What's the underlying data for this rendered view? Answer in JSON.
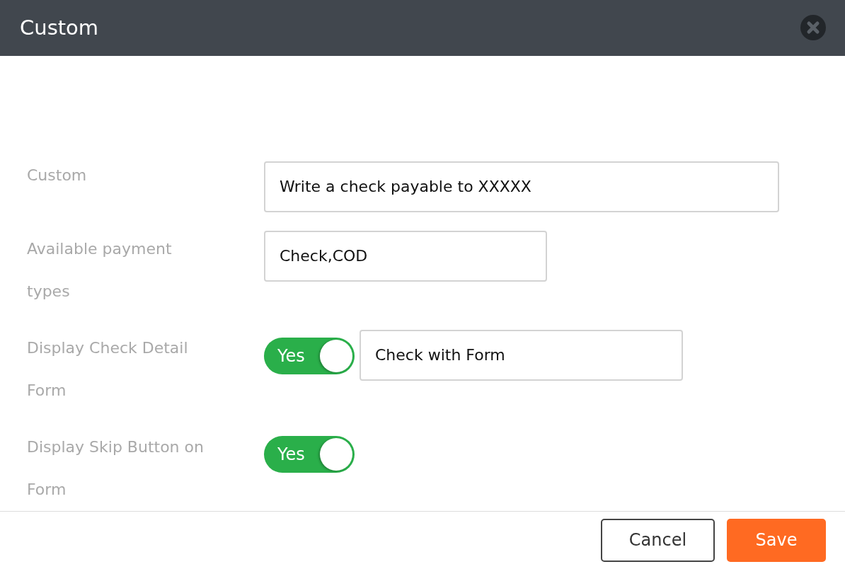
{
  "dialog": {
    "title": "Custom"
  },
  "rows": [
    {
      "kind": "text",
      "label": "Custom",
      "value": "Write a check payable to XXXXX"
    },
    {
      "kind": "text",
      "label": "Available payment types",
      "value": "Check,COD"
    },
    {
      "kind": "toggle_text",
      "label": "Display Check Detail Form",
      "toggle": {
        "on": true,
        "text": "Yes"
      },
      "value": "Check with Form"
    },
    {
      "kind": "toggle",
      "label": "Display Skip Button on Form",
      "toggle": {
        "on": true,
        "text": "Yes"
      }
    }
  ],
  "buttons": [
    {
      "label": "Cancel",
      "kind": "secondary"
    },
    {
      "label": "Save",
      "kind": "primary"
    }
  ]
}
